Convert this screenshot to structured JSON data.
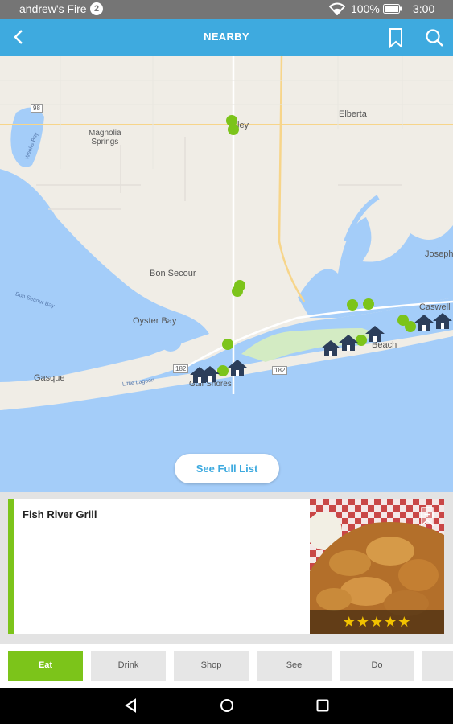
{
  "status_bar": {
    "owner": "andrew's Fire",
    "notification_count": "2",
    "battery": "100%",
    "time": "3:00"
  },
  "header": {
    "title": "NEARBY"
  },
  "map": {
    "labels": {
      "elberta": "Elberta",
      "magnolia_springs": "Magnolia\nSprings",
      "foley": "ley",
      "bon_secour": "Bon Secour",
      "oyster_bay": "Oyster Bay",
      "gasque": "Gasque",
      "caswell": "Caswell",
      "josephine": "Josephi",
      "orange_beach": "Beach",
      "gulf_shores": "Gulf Shores",
      "route_98": "98",
      "route_182a": "182",
      "route_182b": "182",
      "bon_secour_bay": "Bon Secour Bay",
      "weeks_bay": "Weeks Bay",
      "little_lagoon": "Little Lagoon"
    },
    "see_full_list": "See Full List"
  },
  "card": {
    "name": "Fish River Grill",
    "rating": "★★★★★"
  },
  "tabs": [
    "Eat",
    "Drink",
    "Shop",
    "See",
    "Do"
  ],
  "colors": {
    "app_bar": "#3eaadf",
    "accent_green": "#7cc41a",
    "house_marker": "#2c3e5a",
    "water": "#a4cdf9",
    "land": "#f0ede6"
  }
}
